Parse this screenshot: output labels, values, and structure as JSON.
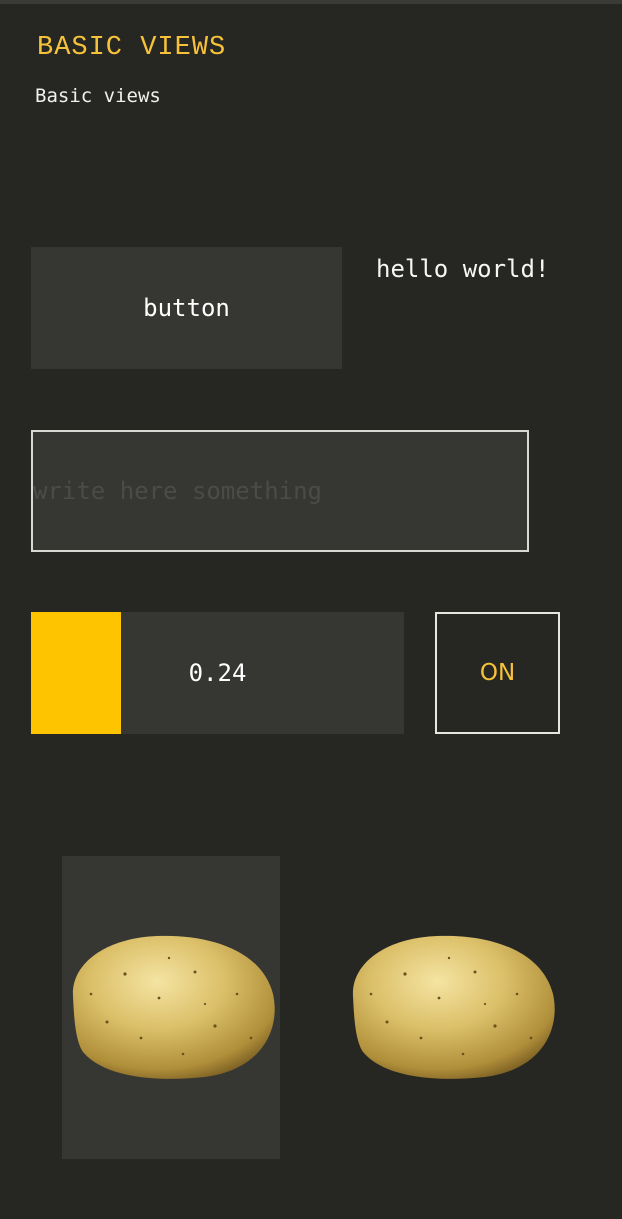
{
  "header": {
    "title": "BASIC VIEWS",
    "subtitle": "Basic views"
  },
  "controls": {
    "button_label": "button",
    "hello_text": "hello world!",
    "text_field": {
      "value": "",
      "placeholder": "write here something"
    },
    "slider": {
      "value": 0.24,
      "label": "0.24"
    },
    "toggle_label": "ON"
  },
  "images": [
    {
      "icon": "potato-image",
      "boxed": true
    },
    {
      "icon": "potato-image",
      "boxed": false
    }
  ],
  "colors": {
    "background": "#262623",
    "panel": "#363633",
    "accent": "#f6c23a",
    "slider_fill": "#ffc400"
  }
}
